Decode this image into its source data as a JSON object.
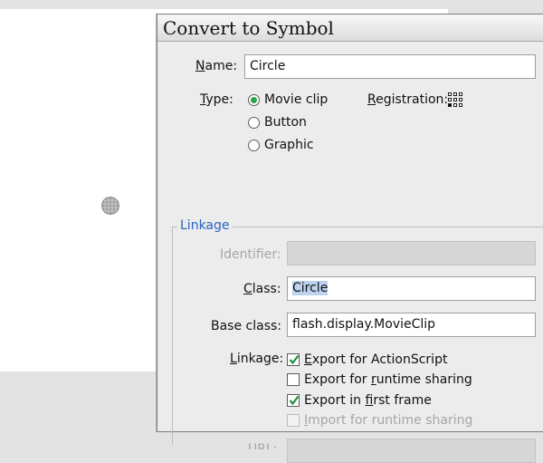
{
  "dialog": {
    "title": "Convert to Symbol",
    "name": {
      "label_u": "N",
      "label_rest": "ame:",
      "value": "Circle"
    },
    "type": {
      "label_u": "T",
      "label_rest": "ype:",
      "options": [
        "Movie clip",
        "Button",
        "Graphic"
      ],
      "selected": "Movie clip"
    },
    "registration": {
      "label_u": "R",
      "label_rest": "egistration:"
    },
    "linkage_group": {
      "legend": "Linkage",
      "identifier": {
        "label": "Identifier:",
        "value": ""
      },
      "class": {
        "label_u": "C",
        "label_rest": "lass:",
        "value": "Circle"
      },
      "base_class": {
        "label": "Base class:",
        "value": "flash.display.MovieClip"
      },
      "linkage_label_u": "L",
      "linkage_label_rest": "inkage:",
      "checkboxes": [
        {
          "pre": "",
          "u": "E",
          "post": "xport for ActionScript",
          "checked": true,
          "enabled": true
        },
        {
          "pre": "Export for ",
          "u": "r",
          "post": "untime sharing",
          "checked": false,
          "enabled": true
        },
        {
          "pre": "Export in ",
          "u": "f",
          "post": "irst frame",
          "checked": true,
          "enabled": true
        },
        {
          "pre": "",
          "u": "I",
          "post": "mport for runtime sharing",
          "checked": false,
          "enabled": false
        }
      ],
      "url_label": "URL:"
    }
  },
  "colors": {
    "accent_legend": "#2a63c2",
    "radio_dot": "#29a64a",
    "check_mark": "#1f8f3e"
  }
}
